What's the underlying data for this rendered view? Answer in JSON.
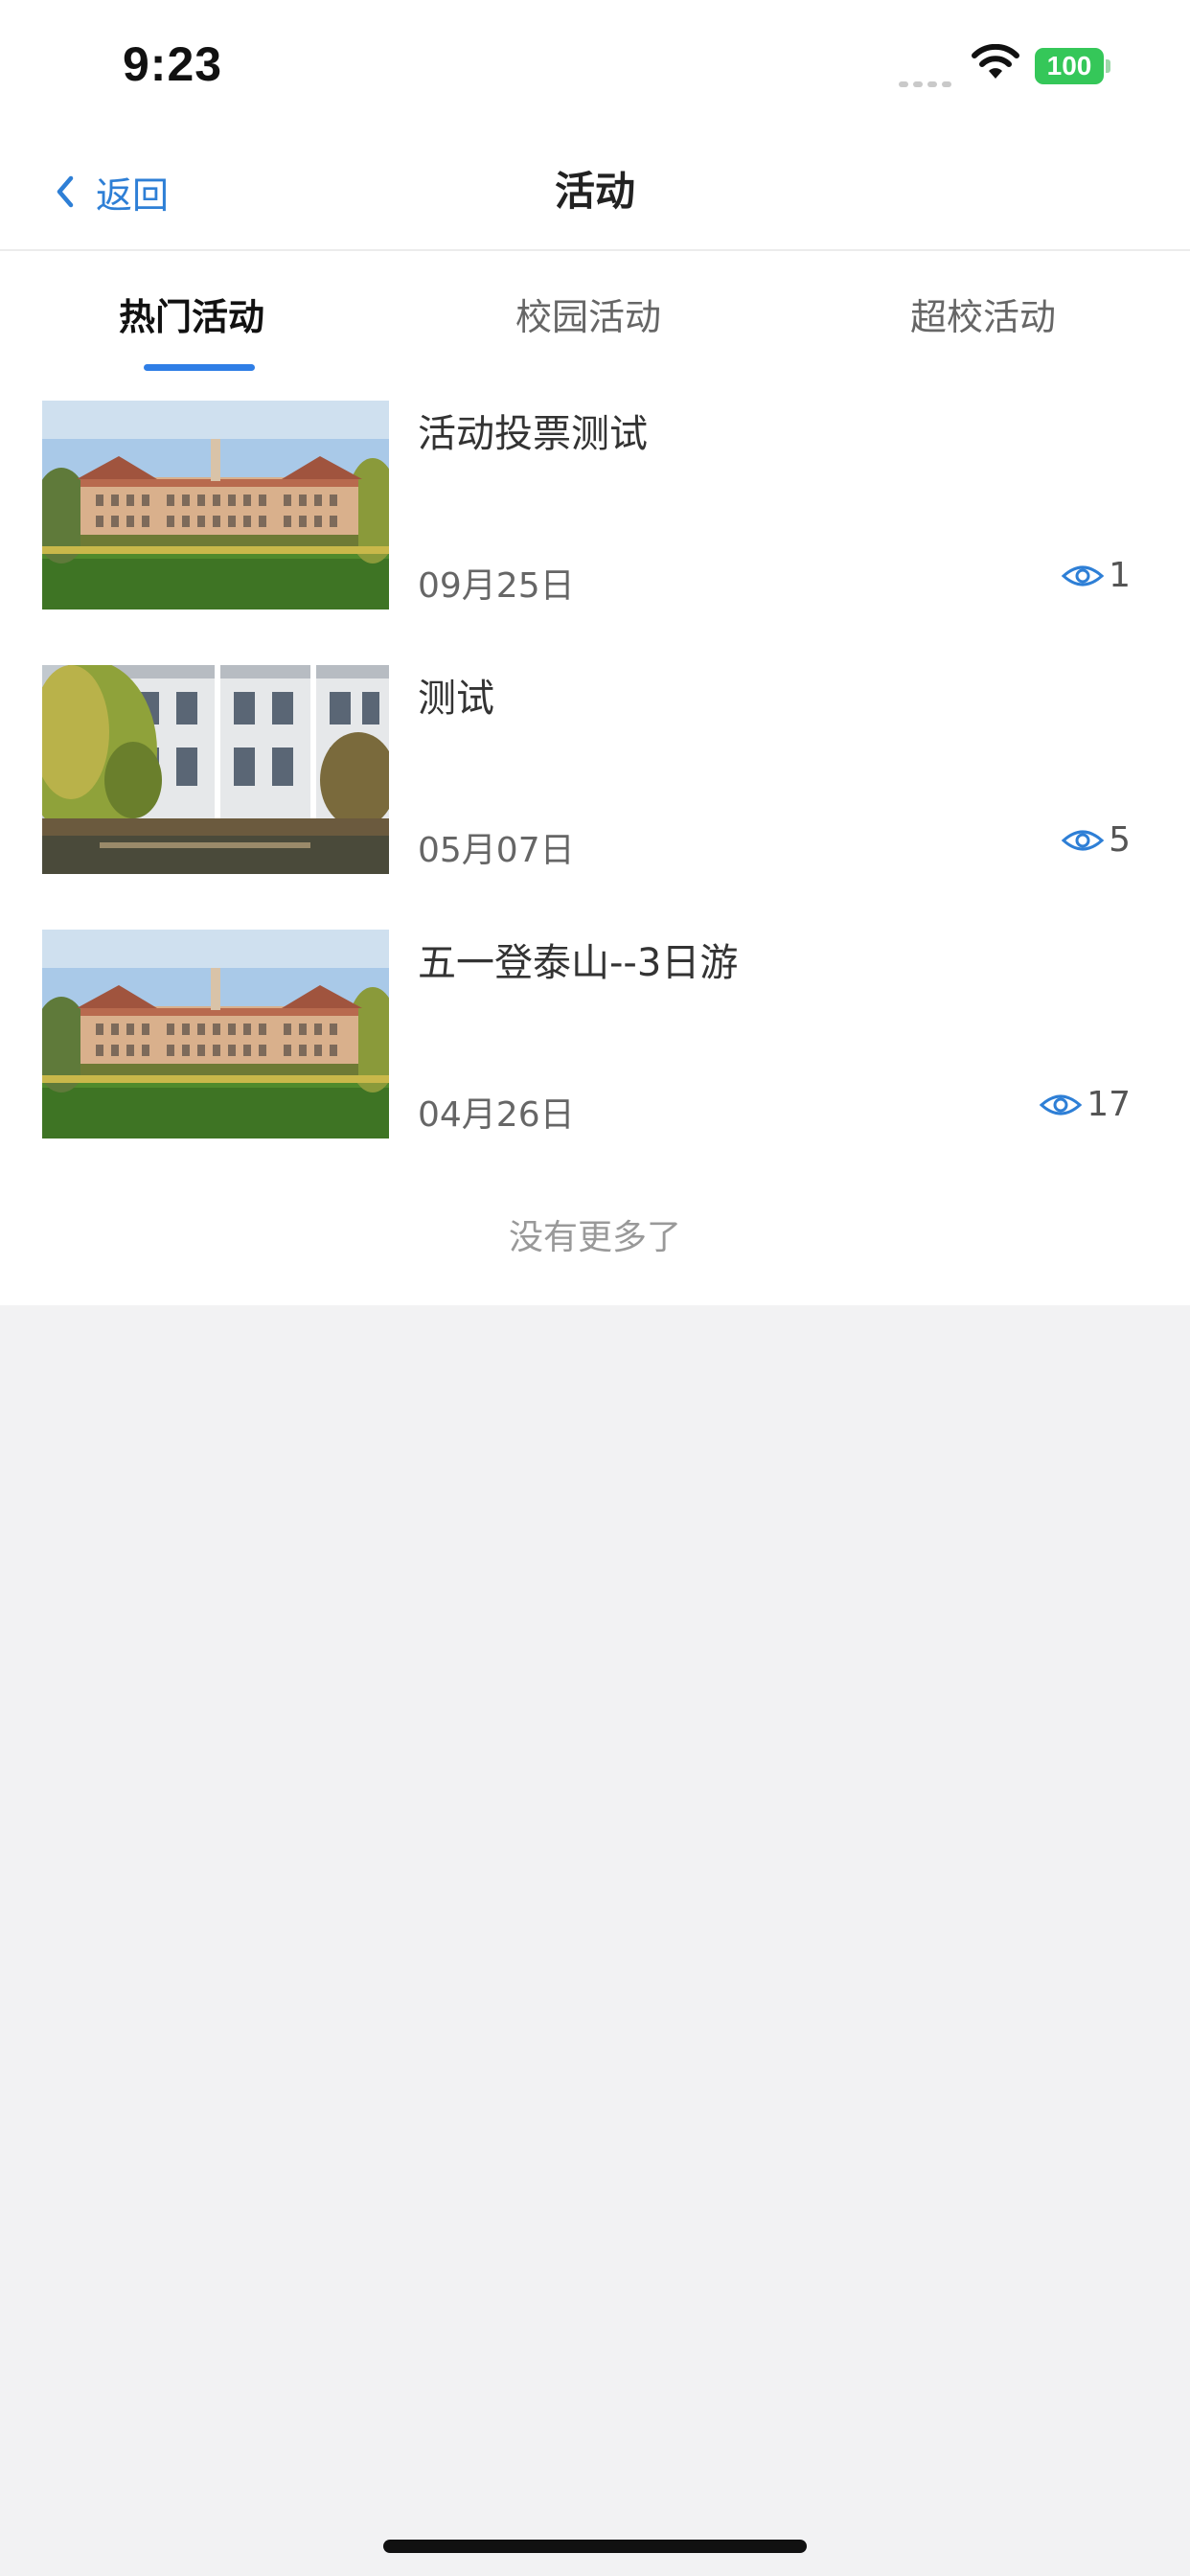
{
  "status_bar": {
    "time": "9:23",
    "battery": "100"
  },
  "nav": {
    "back_label": "返回",
    "title": "活动"
  },
  "tabs": [
    {
      "label": "热门活动",
      "active": true
    },
    {
      "label": "校园活动",
      "active": false
    },
    {
      "label": "超校活动",
      "active": false
    }
  ],
  "activities": [
    {
      "title": "活动投票测试",
      "date": "09月25日",
      "views": "1",
      "image": "campus-building"
    },
    {
      "title": "测试",
      "date": "05月07日",
      "views": "5",
      "image": "lakeside-building"
    },
    {
      "title": "五一登泰山--3日游",
      "date": "04月26日",
      "views": "17",
      "image": "campus-building"
    }
  ],
  "footer": {
    "no_more": "没有更多了"
  },
  "colors": {
    "accent": "#2f7ee6",
    "battery": "#35c759",
    "background": "#f2f2f3"
  }
}
